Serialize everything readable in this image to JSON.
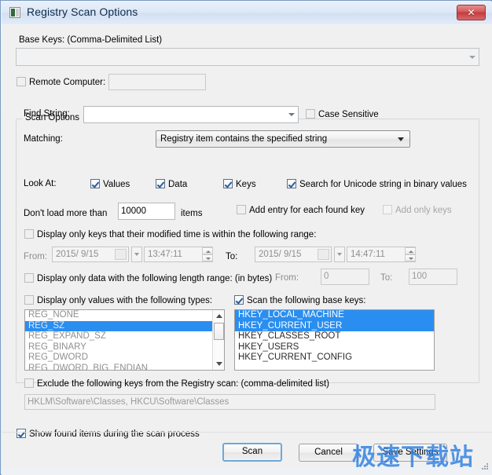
{
  "window": {
    "title": "Registry Scan Options",
    "icon": "registry-icon",
    "close_label": "✕",
    "accent_selection_color": "#2a8ef0",
    "close_color": "#c33c3c"
  },
  "base_keys": {
    "label": "Base Keys:  (Comma-Delimited List)",
    "value": "",
    "dropdown_icon": "chevron-down-icon"
  },
  "remote_computer": {
    "label": "Remote Computer:",
    "checked": false,
    "value": ""
  },
  "scan_options": {
    "group_title": "Scan Options",
    "find_string": {
      "label": "Find String:",
      "value": "",
      "dropdown_icon": "chevron-down-icon"
    },
    "case_sensitive": {
      "label": "Case Sensitive",
      "checked": false
    },
    "matching": {
      "label": "Matching:",
      "value": "Registry item contains the specified string",
      "dropdown_icon": "chevron-down-icon"
    },
    "look_at": {
      "label": "Look At:",
      "items": [
        {
          "label": "Values",
          "checked": true
        },
        {
          "label": "Data",
          "checked": true
        },
        {
          "label": "Keys",
          "checked": true
        }
      ]
    },
    "unicode_search": {
      "label": "Search for Unicode string in binary values",
      "checked": true
    },
    "load_limit": {
      "label_before": "Don't load more than",
      "value": "10000",
      "label_after": "items"
    },
    "add_entry_each_key": {
      "label": "Add entry for each found key",
      "checked": false,
      "disabled": false
    },
    "add_only_keys": {
      "label": "Add only keys",
      "checked": false,
      "disabled": true
    },
    "modified_time_range": {
      "label": "Display only keys that their modified time is within the following range:",
      "checked": false,
      "from_label": "From:",
      "from_date": "2015/  9/15",
      "from_time": "13:47:11",
      "to_label": "To:",
      "to_date": "2015/  9/15",
      "to_time": "14:47:11"
    },
    "length_range": {
      "label": "Display only data with the following length range: (in bytes)",
      "checked": false,
      "from_label": "From:",
      "from_value": "0",
      "to_label": "To:",
      "to_value": "100"
    },
    "value_types": {
      "label": "Display only values with the following types:",
      "checked": false,
      "items": [
        {
          "label": "REG_NONE",
          "selected": false
        },
        {
          "label": "REG_SZ",
          "selected": true
        },
        {
          "label": "REG_EXPAND_SZ",
          "selected": false
        },
        {
          "label": "REG_BINARY",
          "selected": false
        },
        {
          "label": "REG_DWORD",
          "selected": false
        },
        {
          "label": "REG_DWORD_BIG_ENDIAN",
          "selected": false
        }
      ],
      "scrollbar": "vertical-scrollbar"
    },
    "base_keys_list": {
      "label": "Scan the following base keys:",
      "checked": true,
      "items": [
        {
          "label": "HKEY_LOCAL_MACHINE",
          "selected": true
        },
        {
          "label": "HKEY_CURRENT_USER",
          "selected": true
        },
        {
          "label": "HKEY_CLASSES_ROOT",
          "selected": false
        },
        {
          "label": "HKEY_USERS",
          "selected": false
        },
        {
          "label": "HKEY_CURRENT_CONFIG",
          "selected": false
        }
      ]
    },
    "exclude_keys": {
      "label": "Exclude the following keys from the Registry scan: (comma-delimited list)",
      "checked": false,
      "value": "HKLM\\Software\\Classes, HKCU\\Software\\Classes"
    }
  },
  "show_found_items": {
    "label": "Show found items during the scan process",
    "checked": true
  },
  "buttons": {
    "scan": "Scan",
    "cancel": "Cancel",
    "save_settings": "Save Settings"
  },
  "watermark": {
    "text": "极速下载站"
  },
  "resize_grip": "resize-grip-icon"
}
